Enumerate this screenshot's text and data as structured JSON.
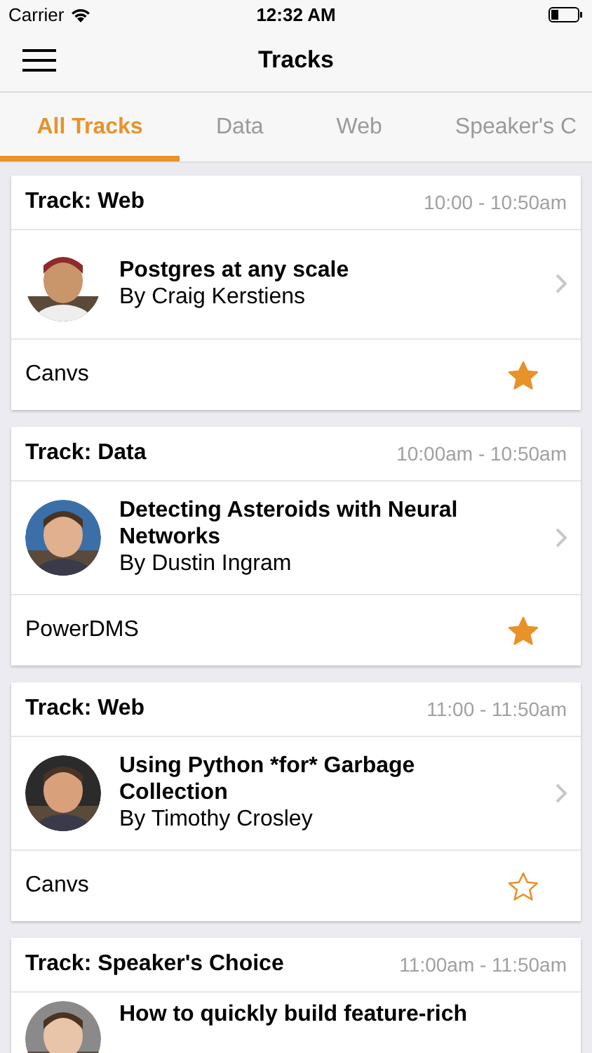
{
  "status_bar": {
    "carrier": "Carrier",
    "time": "12:32 AM"
  },
  "nav_bar": {
    "title": "Tracks"
  },
  "tabs": [
    {
      "label": "All Tracks",
      "selected": true
    },
    {
      "label": "Data",
      "selected": false
    },
    {
      "label": "Web",
      "selected": false
    },
    {
      "label": "Speaker's C",
      "selected": false
    }
  ],
  "sessions": [
    {
      "track": "Track: Web",
      "time": "10:00 - 10:50am",
      "title": "Postgres at any scale",
      "speaker": "By Craig Kerstiens",
      "room": "Canvs",
      "starred": true
    },
    {
      "track": "Track: Data",
      "time": "10:00am - 10:50am",
      "title": "Detecting Asteroids with Neural Networks",
      "speaker": "By Dustin Ingram",
      "room": "PowerDMS",
      "starred": true
    },
    {
      "track": "Track: Web",
      "time": "11:00 - 11:50am",
      "title": "Using Python *for* Garbage Collection",
      "speaker": "By Timothy Crosley",
      "room": "Canvs",
      "starred": false
    },
    {
      "track": "Track: Speaker's Choice",
      "time": "11:00am - 11:50am",
      "title": "How to quickly build feature-rich"
    }
  ]
}
